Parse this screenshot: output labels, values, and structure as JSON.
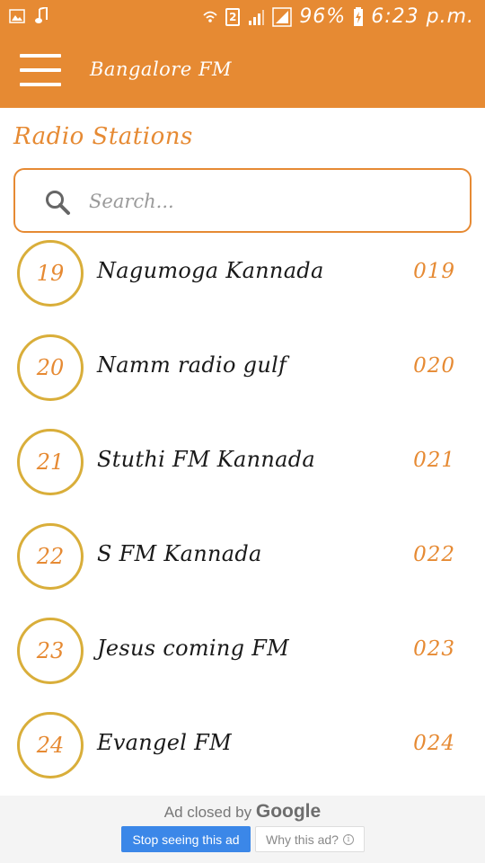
{
  "status_bar": {
    "battery_percent": "96%",
    "time": "6:23 p.m.",
    "sim_badge": "2",
    "icons": [
      "image-icon",
      "music-note-icon",
      "wifi-icon",
      "sim-icon",
      "signal-icon",
      "signal-icon",
      "battery-icon"
    ]
  },
  "app_bar": {
    "title": "Bangalore FM",
    "menu_icon": "hamburger-icon"
  },
  "section": {
    "title": "Radio Stations"
  },
  "search": {
    "placeholder": "Search...",
    "icon": "search-icon"
  },
  "stations": [
    {
      "number": "19",
      "name": "Nagumoga Kannada",
      "code": "019"
    },
    {
      "number": "20",
      "name": "Namm radio gulf",
      "code": "020"
    },
    {
      "number": "21",
      "name": "Stuthi FM Kannada",
      "code": "021"
    },
    {
      "number": "22",
      "name": "S FM Kannada",
      "code": "022"
    },
    {
      "number": "23",
      "name": "Jesus coming FM",
      "code": "023"
    },
    {
      "number": "24",
      "name": "Evangel FM",
      "code": "024"
    }
  ],
  "ad": {
    "closed_text": "Ad closed by",
    "brand": "Google",
    "stop_label": "Stop seeing this ad",
    "why_label": "Why this ad?",
    "info_icon_char": "i"
  },
  "colors": {
    "primary": "#E68A33",
    "circle_border": "#D9AE3A",
    "ad_button": "#3b87e8"
  }
}
